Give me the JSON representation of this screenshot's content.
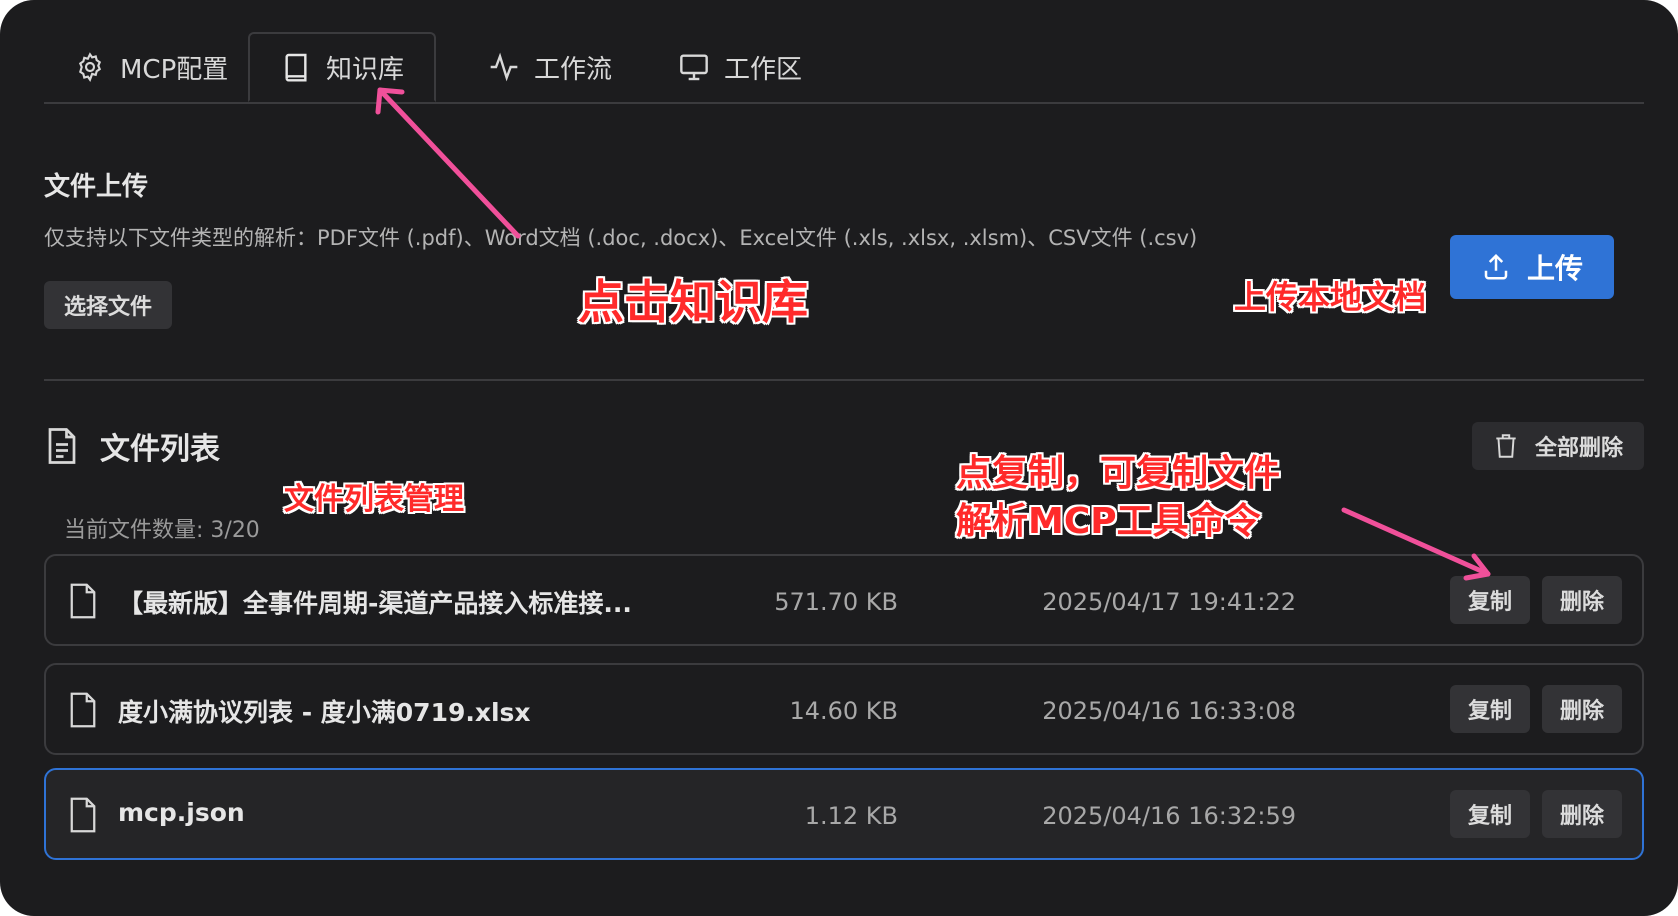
{
  "tabs": [
    {
      "label": "MCP配置",
      "icon": "gear-icon"
    },
    {
      "label": "知识库",
      "icon": "book-icon",
      "active": true
    },
    {
      "label": "工作流",
      "icon": "activity-icon"
    },
    {
      "label": "工作区",
      "icon": "monitor-icon"
    }
  ],
  "upload": {
    "title": "文件上传",
    "hint": "仅支持以下文件类型的解析：PDF文件 (.pdf)、Word文档 (.doc, .docx)、Excel文件 (.xls, .xlsx, .xlsm)、CSV文件 (.csv)",
    "choose_label": "选择文件",
    "upload_label": "上传"
  },
  "file_list": {
    "title": "文件列表",
    "delete_all_label": "全部删除",
    "count_text": "当前文件数量: 3/20",
    "copy_label": "复制",
    "delete_label": "删除",
    "files": [
      {
        "name": "【最新版】全事件周期-渠道产品接入标准接...",
        "size": "571.70 KB",
        "date": "2025/04/17 19:41:22"
      },
      {
        "name": "度小满协议列表 - 度小满0719.xlsx",
        "size": "14.60 KB",
        "date": "2025/04/16 16:33:08"
      },
      {
        "name": "mcp.json",
        "size": "1.12 KB",
        "date": "2025/04/16 16:32:59"
      }
    ]
  },
  "annotations": {
    "click_kb": "点击知识库",
    "upload_local": "上传本地文档",
    "list_manage": "文件列表管理",
    "copy_line1": "点复制，可复制文件",
    "copy_line2": "解析MCP工具命令"
  },
  "colors": {
    "background": "#1c1c1e",
    "accent": "#2f73d6",
    "annotation_text": "#ff2a2a",
    "annotation_arrow": "#f0509a"
  }
}
